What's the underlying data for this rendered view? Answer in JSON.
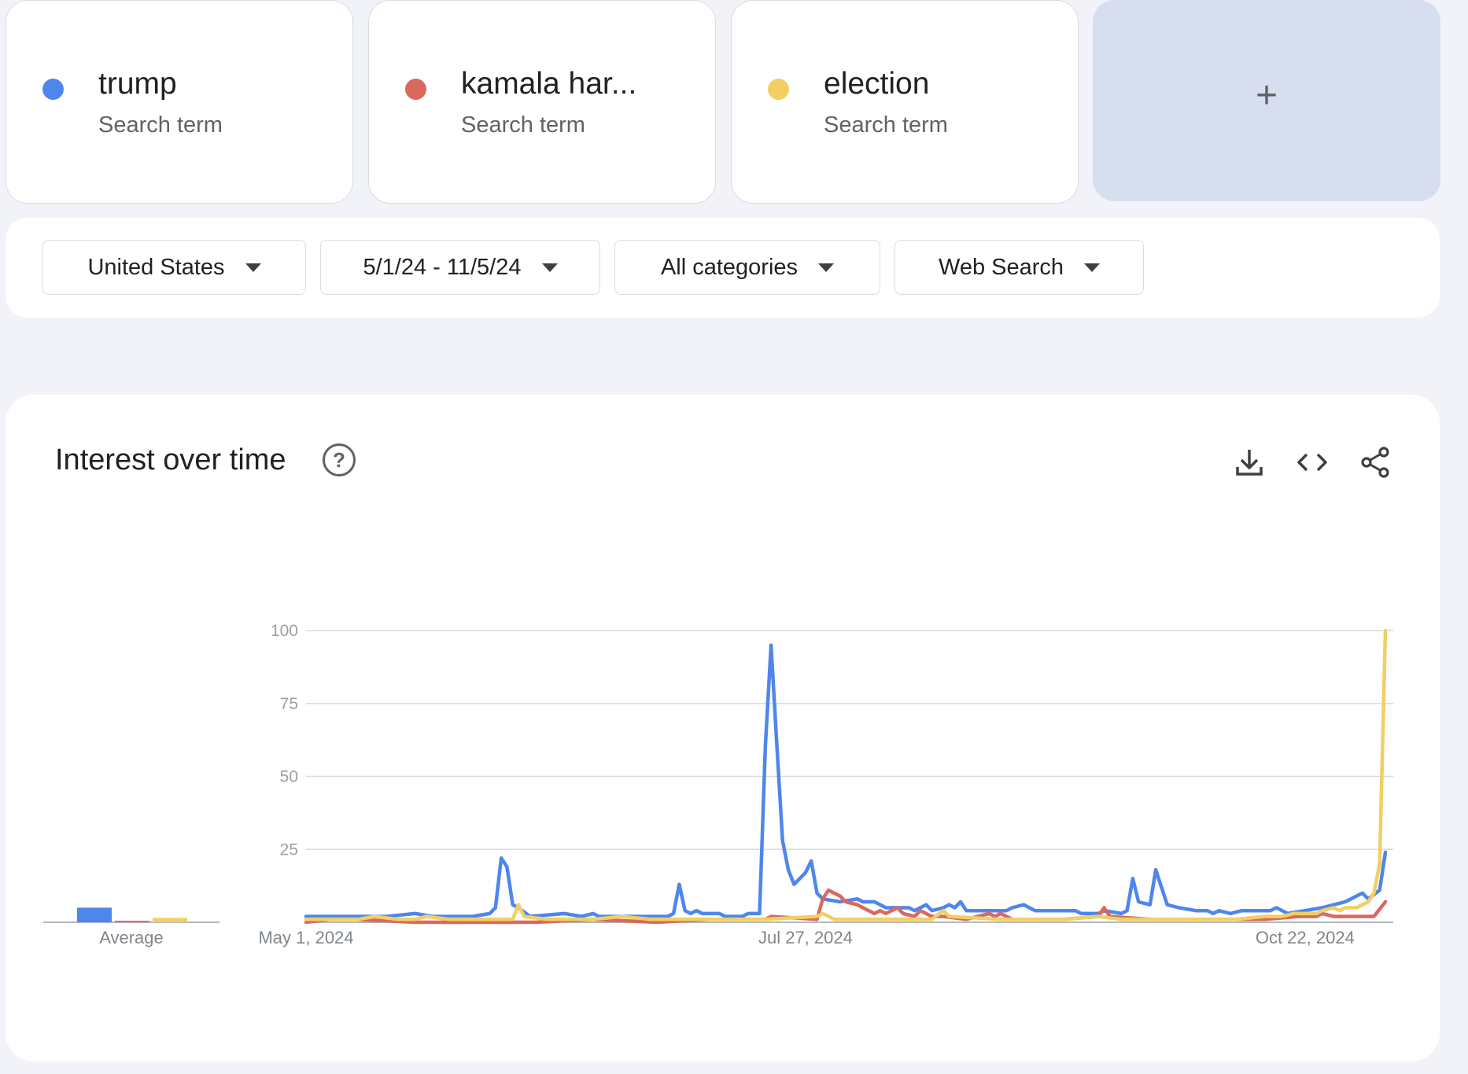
{
  "terms": [
    {
      "name": "trump",
      "subtitle": "Search term",
      "color": "#4f86ec"
    },
    {
      "name": "kamala har...",
      "subtitle": "Search term",
      "color": "#d9695f"
    },
    {
      "name": "election",
      "subtitle": "Search term",
      "color": "#f2cf63"
    }
  ],
  "add_term": {
    "label": "+"
  },
  "filters": {
    "region": "United States",
    "date_range": "5/1/24 - 11/5/24",
    "category": "All categories",
    "search_type": "Web Search"
  },
  "panel": {
    "title": "Interest over time",
    "help_icon": "question-circle-icon",
    "tools": [
      "download-icon",
      "embed-code-icon",
      "share-icon"
    ]
  },
  "chart_data": {
    "type": "line",
    "title": "Interest over time",
    "ylim": [
      0,
      100
    ],
    "y_ticks": [
      "100",
      "75",
      "50",
      "25"
    ],
    "x_ticks": [
      "May 1, 2024",
      "Jul 27, 2024",
      "Oct 22, 2024"
    ],
    "x_start": "2024-05-01",
    "x_end": "2024-11-05",
    "average_label": "Average",
    "averages": [
      {
        "name": "trump",
        "value": 5
      },
      {
        "name": "kamala har...",
        "value": 0.5
      },
      {
        "name": "election",
        "value": 1.5
      }
    ],
    "series": [
      {
        "name": "trump",
        "color": "#4f86ec",
        "points": [
          [
            "2024-05-01",
            2
          ],
          [
            "2024-05-08",
            2
          ],
          [
            "2024-05-15",
            2
          ],
          [
            "2024-05-20",
            3
          ],
          [
            "2024-05-23",
            2
          ],
          [
            "2024-05-30",
            2
          ],
          [
            "2024-06-02",
            3
          ],
          [
            "2024-06-03",
            5
          ],
          [
            "2024-06-04",
            22
          ],
          [
            "2024-06-05",
            19
          ],
          [
            "2024-06-06",
            6
          ],
          [
            "2024-06-07",
            5
          ],
          [
            "2024-06-09",
            2
          ],
          [
            "2024-06-15",
            3
          ],
          [
            "2024-06-18",
            2
          ],
          [
            "2024-06-20",
            3
          ],
          [
            "2024-06-21",
            2
          ],
          [
            "2024-06-27",
            2
          ],
          [
            "2024-07-03",
            2
          ],
          [
            "2024-07-04",
            3
          ],
          [
            "2024-07-05",
            13
          ],
          [
            "2024-07-06",
            4
          ],
          [
            "2024-07-07",
            3
          ],
          [
            "2024-07-08",
            4
          ],
          [
            "2024-07-09",
            3
          ],
          [
            "2024-07-12",
            3
          ],
          [
            "2024-07-13",
            2
          ],
          [
            "2024-07-16",
            2
          ],
          [
            "2024-07-17",
            3
          ],
          [
            "2024-07-19",
            3
          ],
          [
            "2024-07-20",
            60
          ],
          [
            "2024-07-21",
            95
          ],
          [
            "2024-07-22",
            61
          ],
          [
            "2024-07-23",
            28
          ],
          [
            "2024-07-24",
            18
          ],
          [
            "2024-07-25",
            13
          ],
          [
            "2024-07-27",
            17
          ],
          [
            "2024-07-28",
            21
          ],
          [
            "2024-07-29",
            10
          ],
          [
            "2024-07-30",
            8
          ],
          [
            "2024-08-02",
            7
          ],
          [
            "2024-08-05",
            8
          ],
          [
            "2024-08-06",
            7
          ],
          [
            "2024-08-08",
            7
          ],
          [
            "2024-08-10",
            5
          ],
          [
            "2024-08-14",
            5
          ],
          [
            "2024-08-15",
            4
          ],
          [
            "2024-08-17",
            6
          ],
          [
            "2024-08-18",
            4
          ],
          [
            "2024-08-20",
            5
          ],
          [
            "2024-08-21",
            6
          ],
          [
            "2024-08-22",
            5
          ],
          [
            "2024-08-23",
            7
          ],
          [
            "2024-08-24",
            4
          ],
          [
            "2024-08-31",
            4
          ],
          [
            "2024-09-01",
            5
          ],
          [
            "2024-09-03",
            6
          ],
          [
            "2024-09-04",
            5
          ],
          [
            "2024-09-05",
            4
          ],
          [
            "2024-09-12",
            4
          ],
          [
            "2024-09-13",
            3
          ],
          [
            "2024-09-16",
            3
          ],
          [
            "2024-09-17",
            4
          ],
          [
            "2024-09-20",
            3
          ],
          [
            "2024-09-21",
            4
          ],
          [
            "2024-09-22",
            15
          ],
          [
            "2024-09-23",
            7
          ],
          [
            "2024-09-25",
            6
          ],
          [
            "2024-09-26",
            18
          ],
          [
            "2024-09-27",
            12
          ],
          [
            "2024-09-28",
            6
          ],
          [
            "2024-09-30",
            5
          ],
          [
            "2024-10-03",
            4
          ],
          [
            "2024-10-05",
            4
          ],
          [
            "2024-10-06",
            3
          ],
          [
            "2024-10-07",
            4
          ],
          [
            "2024-10-09",
            3
          ],
          [
            "2024-10-11",
            4
          ],
          [
            "2024-10-16",
            4
          ],
          [
            "2024-10-17",
            5
          ],
          [
            "2024-10-19",
            3
          ],
          [
            "2024-10-25",
            5
          ],
          [
            "2024-10-27",
            6
          ],
          [
            "2024-10-29",
            7
          ],
          [
            "2024-11-01",
            10
          ],
          [
            "2024-11-02",
            8
          ],
          [
            "2024-11-04",
            11
          ],
          [
            "2024-11-05",
            24
          ]
        ]
      },
      {
        "name": "kamala har...",
        "color": "#d9695f",
        "points": [
          [
            "2024-05-01",
            0
          ],
          [
            "2024-05-05",
            1
          ],
          [
            "2024-05-10",
            1
          ],
          [
            "2024-05-20",
            0
          ],
          [
            "2024-06-01",
            0
          ],
          [
            "2024-06-10",
            0
          ],
          [
            "2024-06-20",
            1
          ],
          [
            "2024-07-01",
            0
          ],
          [
            "2024-07-10",
            1
          ],
          [
            "2024-07-20",
            1
          ],
          [
            "2024-07-21",
            2
          ],
          [
            "2024-07-29",
            1
          ],
          [
            "2024-07-30",
            8
          ],
          [
            "2024-07-31",
            11
          ],
          [
            "2024-08-02",
            9
          ],
          [
            "2024-08-03",
            7
          ],
          [
            "2024-08-05",
            6
          ],
          [
            "2024-08-06",
            5
          ],
          [
            "2024-08-07",
            4
          ],
          [
            "2024-08-08",
            3
          ],
          [
            "2024-08-09",
            4
          ],
          [
            "2024-08-10",
            3
          ],
          [
            "2024-08-12",
            5
          ],
          [
            "2024-08-13",
            3
          ],
          [
            "2024-08-15",
            2
          ],
          [
            "2024-08-16",
            4
          ],
          [
            "2024-08-18",
            2
          ],
          [
            "2024-08-20",
            2
          ],
          [
            "2024-08-24",
            1
          ],
          [
            "2024-08-28",
            3
          ],
          [
            "2024-08-29",
            2
          ],
          [
            "2024-08-30",
            3
          ],
          [
            "2024-09-01",
            1
          ],
          [
            "2024-09-10",
            1
          ],
          [
            "2024-09-16",
            2
          ],
          [
            "2024-09-17",
            5
          ],
          [
            "2024-09-18",
            2
          ],
          [
            "2024-09-25",
            1
          ],
          [
            "2024-10-05",
            1
          ],
          [
            "2024-10-15",
            1
          ],
          [
            "2024-10-21",
            2
          ],
          [
            "2024-10-24",
            2
          ],
          [
            "2024-10-25",
            3
          ],
          [
            "2024-10-27",
            2
          ],
          [
            "2024-11-01",
            2
          ],
          [
            "2024-11-02",
            2
          ],
          [
            "2024-11-03",
            2
          ],
          [
            "2024-11-05",
            7
          ]
        ]
      },
      {
        "name": "election",
        "color": "#f2cf63",
        "points": [
          [
            "2024-05-01",
            1
          ],
          [
            "2024-05-05",
            1
          ],
          [
            "2024-05-10",
            1
          ],
          [
            "2024-05-13",
            2
          ],
          [
            "2024-05-17",
            1
          ],
          [
            "2024-05-20",
            1
          ],
          [
            "2024-05-22",
            2
          ],
          [
            "2024-05-26",
            1
          ],
          [
            "2024-06-01",
            1
          ],
          [
            "2024-06-06",
            1
          ],
          [
            "2024-06-07",
            6
          ],
          [
            "2024-06-08",
            2
          ],
          [
            "2024-06-12",
            1
          ],
          [
            "2024-06-20",
            1
          ],
          [
            "2024-06-25",
            2
          ],
          [
            "2024-06-30",
            1
          ],
          [
            "2024-07-10",
            1
          ],
          [
            "2024-07-20",
            1
          ],
          [
            "2024-07-29",
            2
          ],
          [
            "2024-07-30",
            3
          ],
          [
            "2024-08-01",
            1
          ],
          [
            "2024-08-10",
            1
          ],
          [
            "2024-08-18",
            1
          ],
          [
            "2024-08-20",
            4
          ],
          [
            "2024-08-21",
            2
          ],
          [
            "2024-08-30",
            1
          ],
          [
            "2024-09-10",
            1
          ],
          [
            "2024-09-16",
            2
          ],
          [
            "2024-09-20",
            1
          ],
          [
            "2024-10-01",
            1
          ],
          [
            "2024-10-10",
            1
          ],
          [
            "2024-10-15",
            2
          ],
          [
            "2024-10-18",
            2
          ],
          [
            "2024-10-20",
            3
          ],
          [
            "2024-10-24",
            3
          ],
          [
            "2024-10-25",
            4
          ],
          [
            "2024-10-27",
            5
          ],
          [
            "2024-10-28",
            4
          ],
          [
            "2024-10-29",
            5
          ],
          [
            "2024-10-31",
            5
          ],
          [
            "2024-11-01",
            6
          ],
          [
            "2024-11-02",
            7
          ],
          [
            "2024-11-03",
            10
          ],
          [
            "2024-11-04",
            20
          ],
          [
            "2024-11-05",
            100
          ]
        ]
      }
    ]
  }
}
